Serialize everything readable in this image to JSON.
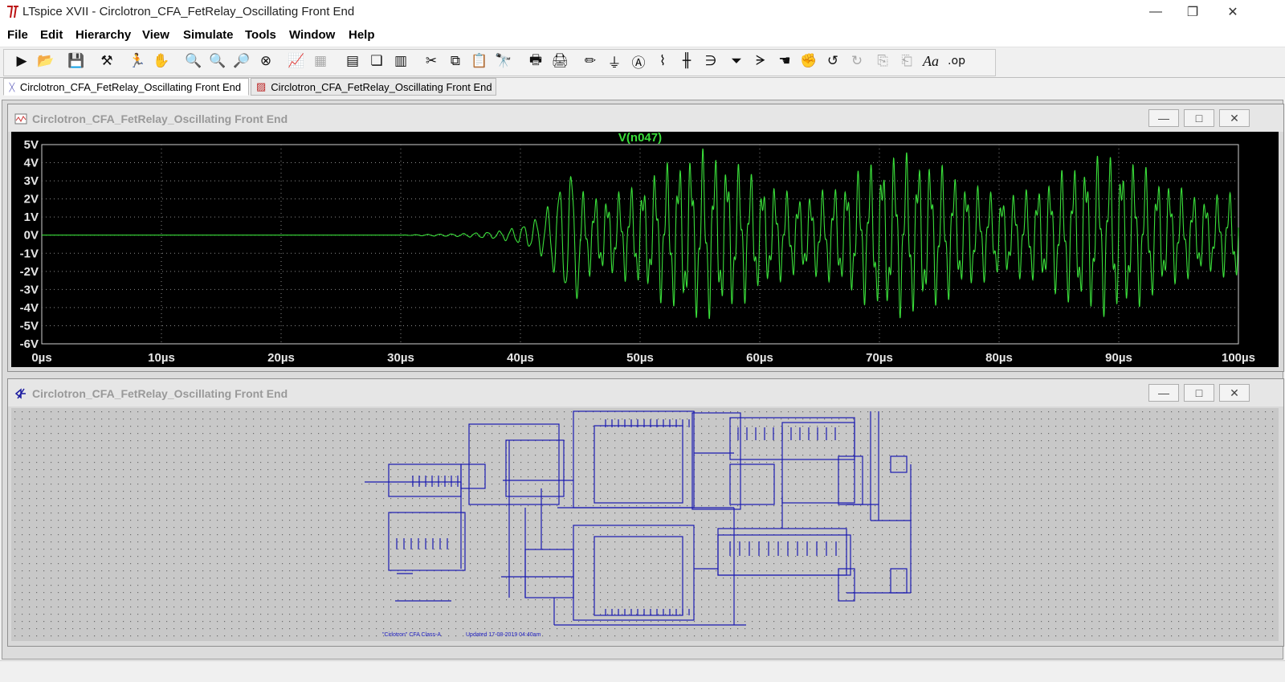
{
  "window": {
    "title": "LTspice XVII - Circlotron_CFA_FetRelay_Oscillating Front End",
    "minimize": "—",
    "restore": "❐",
    "close": "✕"
  },
  "menu": [
    "File",
    "Edit",
    "Hierarchy",
    "View",
    "Simulate",
    "Tools",
    "Window",
    "Help"
  ],
  "toolbar": {
    "icons": [
      "run-icon",
      "open-icon",
      "save-icon",
      "control-panel-icon",
      "halt-icon",
      "pan-icon",
      "zoom-in-icon",
      "zoom-area-icon",
      "zoom-out-icon",
      "zoom-fit-icon",
      "autorange-icon",
      "waveform-icon",
      "tile-horizontal-icon",
      "cascade-icon",
      "tile-vertical-icon",
      "cut-icon",
      "copy-icon",
      "paste-icon",
      "find-icon",
      "print-icon",
      "print-setup-icon",
      "draw-wire-icon",
      "ground-icon",
      "label-net-icon",
      "resistor-icon",
      "capacitor-icon",
      "inductor-icon",
      "diode-icon",
      "component-icon",
      "move-icon",
      "drag-icon",
      "undo-icon",
      "redo-icon",
      "rotate-icon",
      "mirror-icon",
      "text-icon",
      "spice-directive-icon"
    ],
    "text_aa": "Aa",
    "text_op": ".op"
  },
  "tabs": [
    {
      "label": "Circlotron_CFA_FetRelay_Oscillating Front End",
      "icon": "schematic-icon",
      "active": true
    },
    {
      "label": "Circlotron_CFA_FetRelay_Oscillating Front End",
      "icon": "waveform-icon",
      "active": false
    }
  ],
  "plot_window": {
    "title": "Circlotron_CFA_FetRelay_Oscillating Front End",
    "min": "—",
    "max": "□",
    "close": "✕"
  },
  "schematic_window": {
    "title": "Circlotron_CFA_FetRelay_Oscillating Front End",
    "min": "—",
    "max": "□",
    "close": "✕",
    "caption_left": "\"Cirlotron\" CFA Class-A",
    "caption_right": "Updated 17-08-2019 04:40am"
  },
  "chart_data": {
    "type": "line",
    "title": "V(n047)",
    "x_unit": "µs",
    "xlim": [
      0,
      100
    ],
    "ylim": [
      -6,
      5
    ],
    "x_ticks": [
      "0µs",
      "10µs",
      "20µs",
      "30µs",
      "40µs",
      "50µs",
      "60µs",
      "70µs",
      "80µs",
      "90µs",
      "100µs"
    ],
    "y_ticks": [
      "5V",
      "4V",
      "3V",
      "2V",
      "1V",
      "0V",
      "-1V",
      "-2V",
      "-3V",
      "-4V",
      "-5V",
      "-6V"
    ],
    "grid": true,
    "background": "#000000",
    "trace_color": "#3adf3a",
    "series": [
      {
        "name": "V(n047)",
        "description_points": {
          "x": [
            0,
            30,
            32,
            35,
            38,
            40,
            41,
            42,
            43,
            44,
            45,
            50,
            55,
            60,
            65,
            70,
            75,
            80,
            85,
            90,
            95,
            100
          ],
          "envelope": [
            0,
            0,
            0.05,
            0.1,
            0.25,
            0.6,
            1.0,
            1.6,
            3.0,
            4.5,
            4.5,
            4.5,
            4.8,
            4.6,
            4.6,
            4.7,
            4.5,
            4.7,
            4.6,
            4.5,
            4.4,
            4.5
          ]
        }
      }
    ]
  }
}
